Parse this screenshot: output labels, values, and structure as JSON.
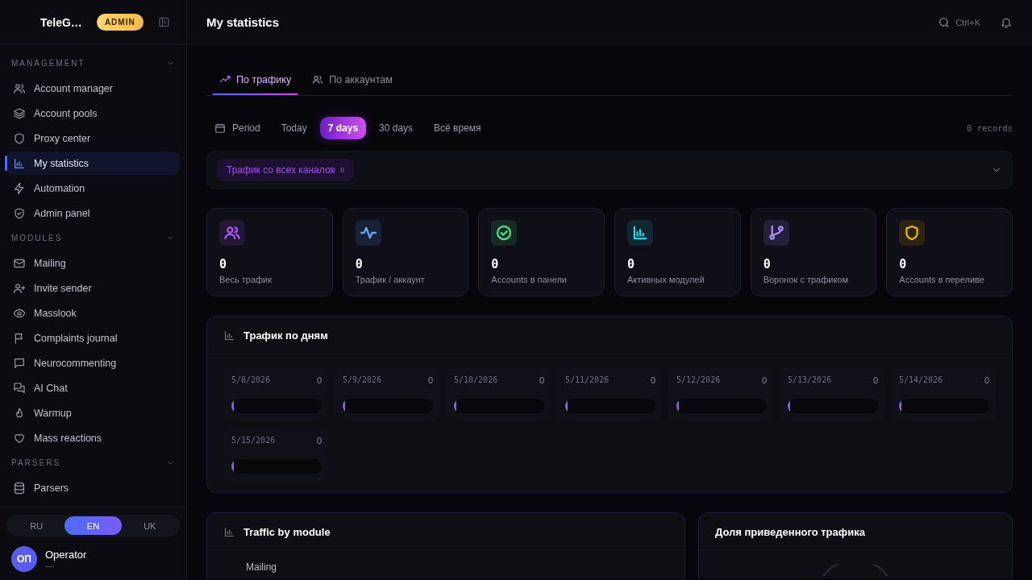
{
  "sidebar": {
    "brand": "TeleG…",
    "badge": "ADMIN",
    "sections": [
      {
        "title": "MANAGEMENT",
        "expanded": true,
        "items": [
          {
            "label": "Account manager",
            "selected": false
          },
          {
            "label": "Account pools",
            "selected": false
          },
          {
            "label": "Proxy center",
            "selected": false
          },
          {
            "label": "My statistics",
            "selected": true
          },
          {
            "label": "Automation",
            "selected": false
          },
          {
            "label": "Admin panel",
            "selected": false
          }
        ]
      },
      {
        "title": "MODULES",
        "expanded": true,
        "items": [
          {
            "label": "Mailing",
            "selected": false
          },
          {
            "label": "Invite sender",
            "selected": false
          },
          {
            "label": "Masslook",
            "selected": false
          },
          {
            "label": "Complaints journal",
            "selected": false
          },
          {
            "label": "Neurocommenting",
            "selected": false
          },
          {
            "label": "AI Chat",
            "selected": false
          },
          {
            "label": "Warmup",
            "selected": false
          },
          {
            "label": "Mass reactions",
            "selected": false
          }
        ]
      },
      {
        "title": "PARSERS",
        "expanded": true,
        "items": [
          {
            "label": "Parsers",
            "selected": false
          }
        ]
      }
    ],
    "languages": [
      {
        "label": "RU",
        "selected": false
      },
      {
        "label": "EN",
        "selected": true
      },
      {
        "label": "UK",
        "selected": false
      }
    ],
    "user": {
      "initials": "ОП",
      "name": "Operator",
      "subtitle": "—"
    }
  },
  "header": {
    "title": "My statistics",
    "search_hint": "Ctrl+K"
  },
  "tabs": [
    {
      "label": "По трафику",
      "selected": true
    },
    {
      "label": "По аккаунтам",
      "selected": false
    }
  ],
  "periods": [
    {
      "label": "Period",
      "selected": false
    },
    {
      "label": "Today",
      "selected": false
    },
    {
      "label": "7 days",
      "selected": true
    },
    {
      "label": "30 days",
      "selected": false
    },
    {
      "label": "Всё время",
      "selected": false
    }
  ],
  "records": "0 records",
  "channel_filter": {
    "label": "Трафик со всех каналов",
    "count": "8"
  },
  "stats": [
    {
      "value": "0",
      "label": "Весь трафик",
      "color": "#a855f7"
    },
    {
      "value": "0",
      "label": "Трафик / аккаунт",
      "color": "#60a5fa"
    },
    {
      "value": "0",
      "label": "Accounts в панели",
      "color": "#4ade80"
    },
    {
      "value": "0",
      "label": "Активных модулей",
      "color": "#22d3ee"
    },
    {
      "value": "0",
      "label": "Воронок с трафиком",
      "color": "#a78bfa"
    },
    {
      "value": "0",
      "label": "Accounts в переливе",
      "color": "#eab308"
    }
  ],
  "daily": {
    "title": "Трафик по дням",
    "days": [
      {
        "date": "5/8/2026",
        "count": "0",
        "level": 0
      },
      {
        "date": "5/9/2026",
        "count": "0",
        "level": 0
      },
      {
        "date": "5/10/2026",
        "count": "0",
        "level": 0
      },
      {
        "date": "5/11/2026",
        "count": "0",
        "level": 0
      },
      {
        "date": "5/12/2026",
        "count": "0",
        "level": 0
      },
      {
        "date": "5/13/2026",
        "count": "0",
        "level": 0
      },
      {
        "date": "5/14/2026",
        "count": "0",
        "level": 0
      },
      {
        "date": "5/15/2026",
        "count": "0",
        "level": 0
      }
    ]
  },
  "modules_panel": {
    "title": "Traffic by module",
    "rows": [
      "Mailing"
    ]
  },
  "share_panel": {
    "title": "Доля приведенного трафика"
  }
}
